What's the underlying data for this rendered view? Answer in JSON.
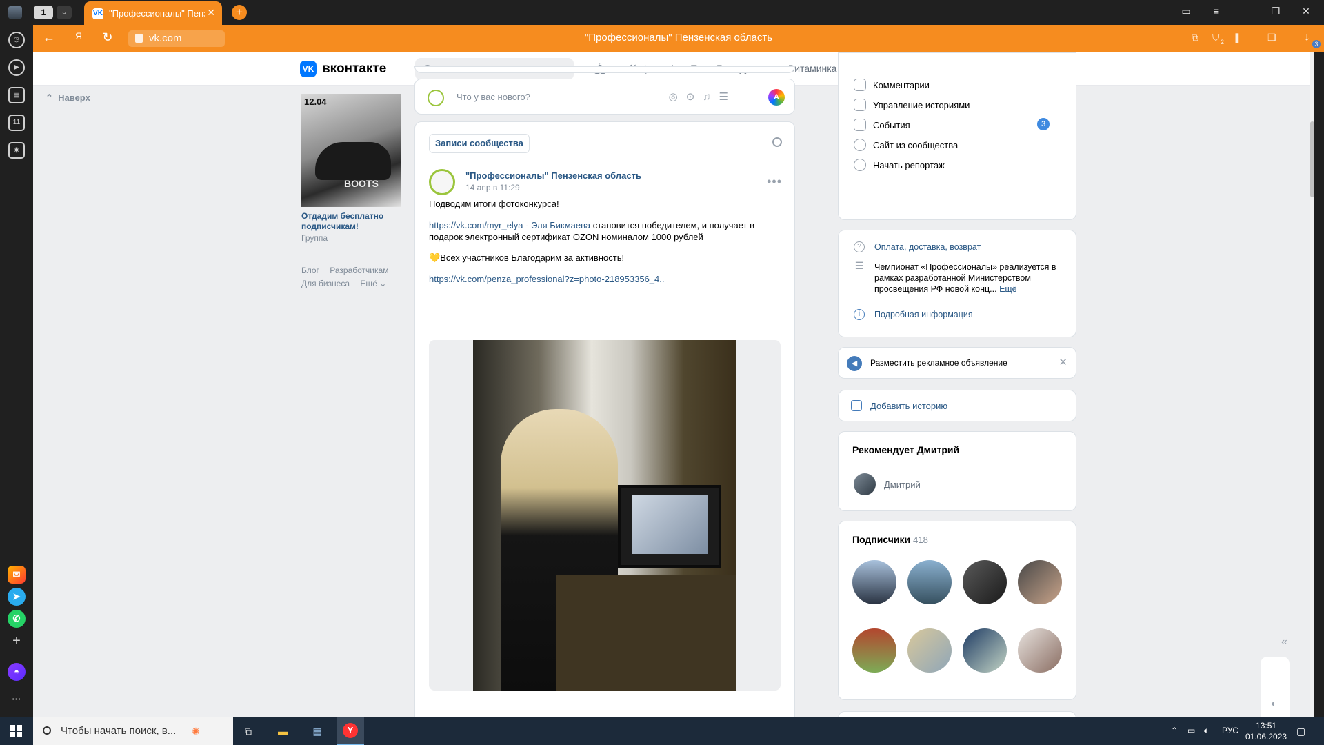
{
  "browser": {
    "tab_count": "1",
    "tab_dropdown_icon": "chevron-down-icon",
    "active_tab_title": "\"Профессионалы\" Пензенская область",
    "favicon_text": "VK",
    "url": "vk.com",
    "page_title": "\"Профессионалы\" Пензенская область",
    "accent_color": "#f68c1f",
    "downloads_badge": "3",
    "sidebar_badge": "2"
  },
  "vk_header": {
    "logo_letter": "VK",
    "brand": "вконтакте",
    "search_placeholder": "Поиск",
    "now_playing": "Тима Белорусских — Витаминка"
  },
  "left_column": {
    "up_label": "Наверх",
    "ad": {
      "image_date": "12.04",
      "image_word": "BOOTS",
      "title": "Отдадим бесплатно подписчикам!",
      "subtitle": "Группа"
    },
    "footer_links": [
      "Блог",
      "Разработчикам",
      "Для бизнеса",
      "Ещё ⌄"
    ]
  },
  "composer": {
    "placeholder": "Что у вас нового?"
  },
  "feed": {
    "tab_label": "Записи сообщества",
    "post": {
      "author": "\"Профессионалы\" Пензенская область",
      "date": "14 апр в 11:29",
      "line1": "Подводим итоги фотоконкурса!",
      "link1": "https://vk.com/myr_elya",
      "dash": " - ",
      "winner": "Эля Бикмаева",
      "line2_rest": " становится победителем, и получает в подарок электронный сертификат OZON номиналом 1000 рублей",
      "heart": "💛",
      "line3": "Всех участников Благодарим за активность!",
      "link2": "https://vk.com/penza_professional?z=photo-218953356_4.."
    }
  },
  "right_menu": {
    "items": [
      {
        "label": "Комментарии",
        "icon": "comment-icon"
      },
      {
        "label": "Управление историями",
        "icon": "stories-icon"
      },
      {
        "label": "События",
        "icon": "events-icon"
      },
      {
        "label": "Сайт из сообщества",
        "icon": "globe-icon"
      },
      {
        "label": "Начать репортаж",
        "icon": "broadcast-icon"
      }
    ],
    "events_badge": "3"
  },
  "info": {
    "payment": "Оплата, доставка, возврат",
    "description": "Чемпионат «Профессионалы» реализуется в рамках разработанной Министерством просвещения РФ новой конц...",
    "more": "Ещё",
    "details": "Подробная информация"
  },
  "ad_block": {
    "label": "Разместить рекламное объявление"
  },
  "story_block": {
    "label": "Добавить историю"
  },
  "recommend": {
    "title": "Рекомендует Дмитрий",
    "name": "Дмитрий"
  },
  "subscribers": {
    "title": "Подписчики",
    "count": "418"
  },
  "taskbar": {
    "search_placeholder": "Чтобы начать поиск, в...",
    "lang": "РУС",
    "time": "13:51",
    "date": "01.06.2023"
  }
}
